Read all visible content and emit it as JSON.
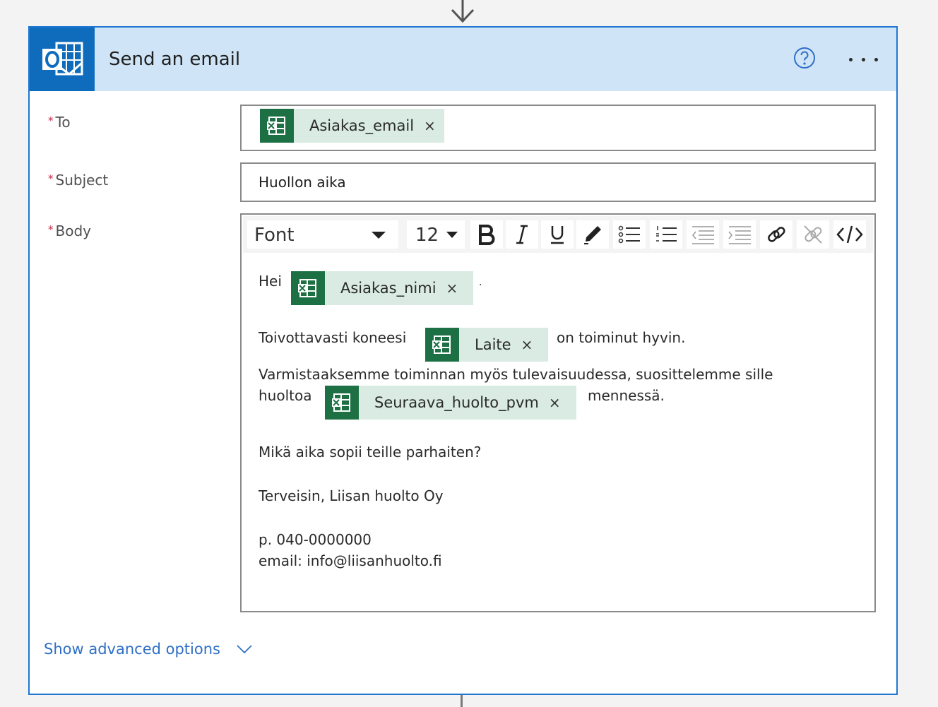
{
  "card": {
    "title": "Send an email",
    "colors": {
      "accent": "#1f77d2",
      "header": "#cfe4f6",
      "app_icon": "#0f6cbd",
      "token_icon": "#1d7044",
      "token_bg": "#d9ebe2",
      "link": "#2f6fc6"
    }
  },
  "fields": {
    "to": {
      "label": "To",
      "token": "Asiakas_email"
    },
    "subject": {
      "label": "Subject",
      "value": "Huollon aika"
    },
    "body": {
      "label": "Body"
    }
  },
  "toolbar": {
    "font": "Font",
    "size": "12"
  },
  "body": {
    "greeting": "Hei",
    "name_token": "Asiakas_nimi",
    "greeting_suffix": "·",
    "line2_pre": "Toivottavasti koneesi",
    "device_token": "Laite",
    "line2_post": "on toiminut hyvin.",
    "line3": "Varmistaaksemme toiminnan myös tulevaisuudessa, suosittelemme sille",
    "line4_pre": "huoltoa",
    "date_token": "Seuraava_huolto_pvm",
    "line4_post": "mennessä.",
    "question": "Mikä aika sopii teille parhaiten?",
    "signature": "Terveisin, Liisan huolto Oy",
    "phone": "p. 040-0000000",
    "email": "email: info@liisanhuolto.fi"
  },
  "required_mark": "*",
  "token_remove": "×",
  "advanced_options": "Show advanced options"
}
